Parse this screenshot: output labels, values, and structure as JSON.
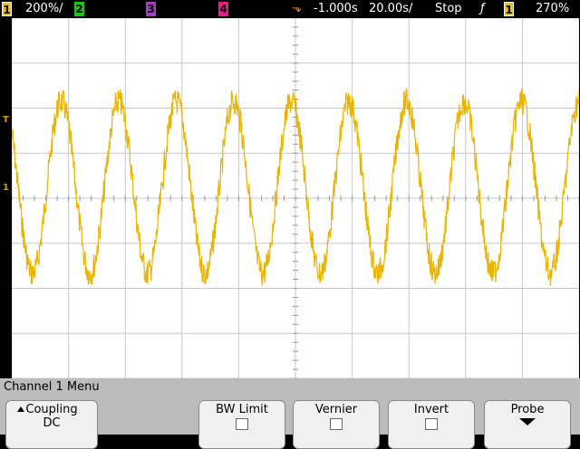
{
  "status_bar": {
    "ch1_label": "1",
    "ch1_scale": "200%/",
    "ch2_label": "2",
    "ch3_label": "3",
    "ch4_label": "4",
    "delay": "-1.000s",
    "timebase": "20.00s/",
    "run_state": "Stop",
    "trigger_slope_icon": "rising-edge-icon",
    "trigger_source": "1",
    "trigger_level": "270%"
  },
  "screen": {
    "trace_color": "#e8b400",
    "grid_color": "#c8c8c8",
    "trigger_marker": "T",
    "ch1_ground_marker": "1"
  },
  "menu": {
    "title": "Channel 1  Menu",
    "softkeys": [
      {
        "label": "Coupling",
        "value": "DC"
      },
      {
        "label": "BW Limit",
        "value": ""
      },
      {
        "label": "Vernier",
        "value": ""
      },
      {
        "label": "Invert",
        "value": ""
      },
      {
        "label": "Probe",
        "value": ""
      }
    ]
  }
}
